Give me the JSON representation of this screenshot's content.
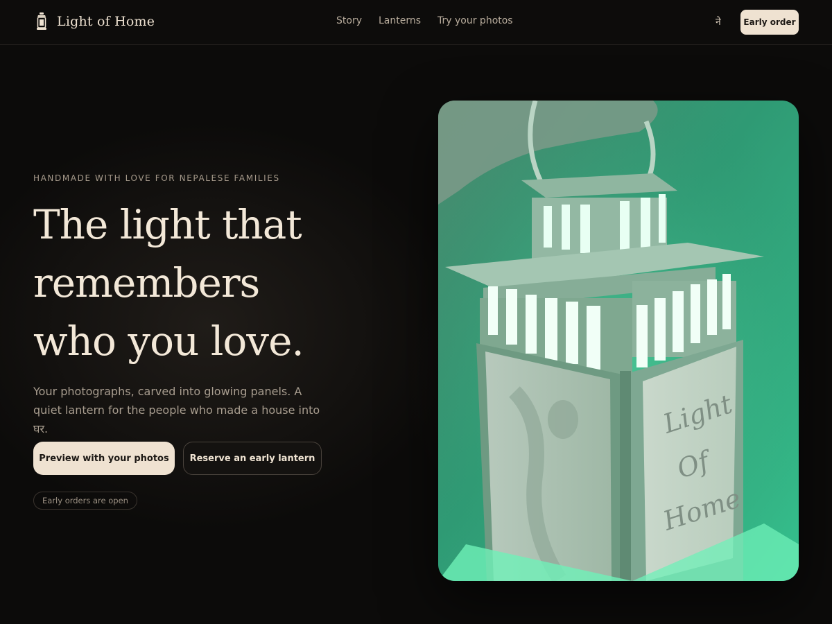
{
  "header": {
    "brand_name": "Light of Home",
    "brand_icon": "lantern-icon",
    "nav": [
      {
        "label": "Story"
      },
      {
        "label": "Lanterns"
      },
      {
        "label": "Try your photos"
      }
    ],
    "language_toggle": "ने",
    "cta_label": "Early order"
  },
  "hero": {
    "eyebrow": "HANDMADE WITH LOVE FOR NEPALESE FAMILIES",
    "title_lines": [
      "The light that",
      "remembers",
      "who you love."
    ],
    "lede": "Your photographs, carved into glowing panels. A quiet lantern for the people who made a house into घर.",
    "primary_cta": "Preview with your photos",
    "secondary_cta": "Reserve an early lantern",
    "status_badge": "Early orders are open"
  },
  "product_image": {
    "panel_text_lines": [
      "Light",
      "Of",
      "Home"
    ],
    "glow_color": "#39d39a"
  },
  "colors": {
    "background": "#0c0b0a",
    "cream": "#efe2d1",
    "muted_text": "#a99e90"
  }
}
